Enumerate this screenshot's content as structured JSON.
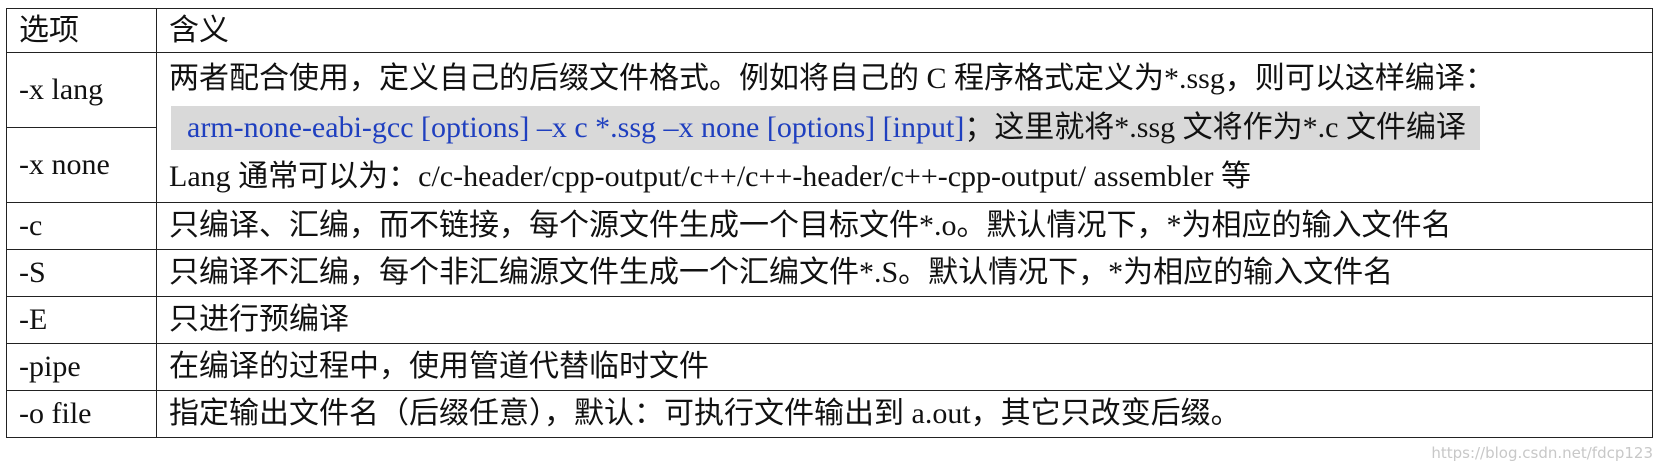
{
  "headers": {
    "option": "选项",
    "meaning": "含义"
  },
  "lang_block": {
    "option_x_lang": "-x lang",
    "option_x_none": "-x none",
    "line1": "两者配合使用，定义自己的后缀文件格式。例如将自己的 C 程序格式定义为*.ssg，则可以这样编译：",
    "code_command": "arm-none-eabi-gcc [options] –x c *.ssg –x none [options] [input]",
    "code_note": "；这里就将*.ssg 文将作为*.c 文件编译",
    "line3": "Lang 通常可以为：c/c-header/cpp-output/c++/c++-header/c++-cpp-output/ assembler 等"
  },
  "rows": [
    {
      "option": "-c",
      "meaning": "只编译、汇编，而不链接，每个源文件生成一个目标文件*.o。默认情况下，*为相应的输入文件名"
    },
    {
      "option": "-S",
      "meaning": "只编译不汇编，每个非汇编源文件生成一个汇编文件*.S。默认情况下，*为相应的输入文件名"
    },
    {
      "option": "-E",
      "meaning": "只进行预编译"
    },
    {
      "option": "-pipe",
      "meaning": "在编译的过程中，使用管道代替临时文件"
    },
    {
      "option": "-o file",
      "meaning": "指定输出文件名（后缀任意），默认：可执行文件输出到 a.out，其它只改变后缀。"
    }
  ],
  "watermark": "https://blog.csdn.net/fdcp123"
}
